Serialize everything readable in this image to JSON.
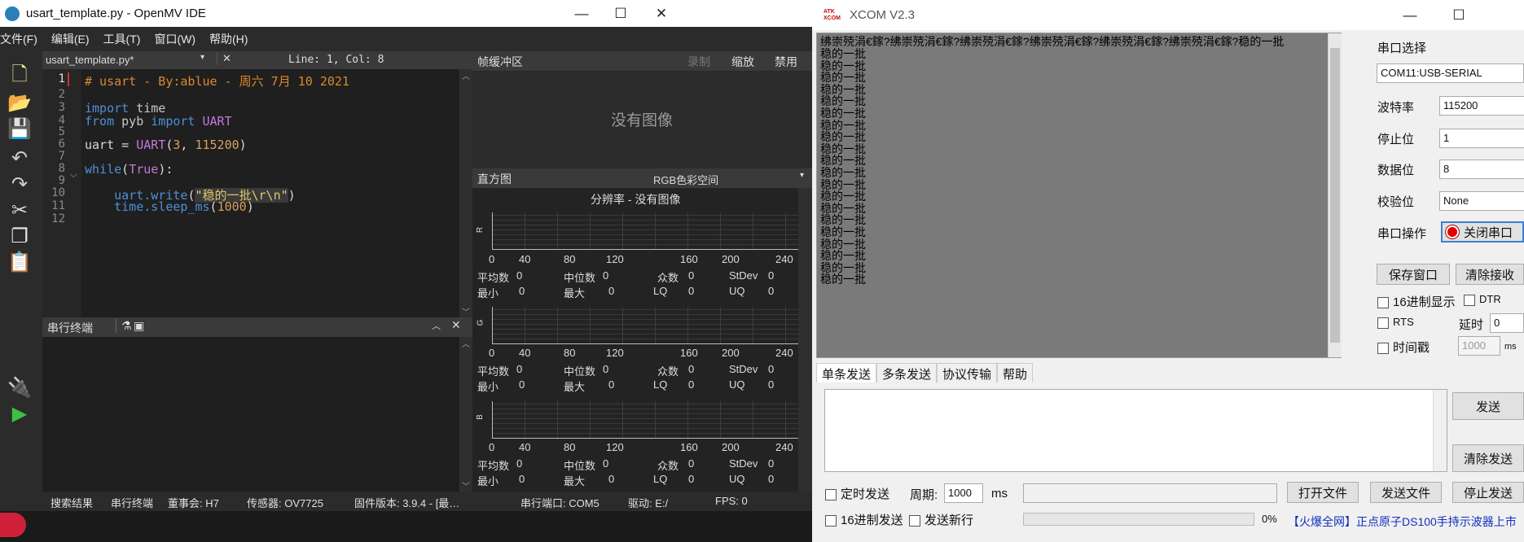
{
  "openmv": {
    "title": "usart_template.py - OpenMV IDE",
    "menu": [
      "文件(F)",
      "编辑(E)",
      "工具(T)",
      "窗口(W)",
      "帮助(H)"
    ],
    "editor": {
      "tab": "usart_template.py*",
      "line_col": "Line: 1, Col: 8",
      "line_numbers": [
        "1",
        "2",
        "3",
        "4",
        "5",
        "6",
        "7",
        "8",
        "9",
        "10",
        "11",
        "12"
      ],
      "lines": [
        "# usart - By:ablue - 周六 7月 10 2021",
        "",
        "import time",
        "from pyb import UART",
        "",
        "uart = UART(3, 115200)",
        "",
        "while(True):",
        "",
        "    uart.write(\"稳的一批\\r\\n\")",
        "    time.sleep_ms(1000)",
        ""
      ]
    },
    "terminal": {
      "title": "串行终端"
    },
    "framebuffer": {
      "title": "帧缓冲区",
      "record": "录制",
      "zoom": "缩放",
      "disable": "禁用",
      "no_image": "没有图像"
    },
    "histogram": {
      "title": "直方图",
      "colorspace": "RGB色彩空间",
      "resolution": "分辨率 - 没有图像",
      "channels": [
        "R",
        "G",
        "B"
      ],
      "ticks": [
        "0",
        "40",
        "80",
        "120",
        "160",
        "200",
        "240"
      ],
      "stats_row1": {
        "mean": "平均数",
        "median": "中位数",
        "mode": "众数",
        "stdev": "StDev"
      },
      "stats_row2": {
        "min": "最小",
        "max": "最大",
        "lq": "LQ",
        "uq": "UQ"
      },
      "zero": "0"
    },
    "status": {
      "search": "搜索结果",
      "serial": "串行终端",
      "board": "董事会: H7",
      "sensor": "传感器: OV7725",
      "firmware": "固件版本: 3.9.4 - [最…",
      "port": "串行端口: COM5",
      "drive": "驱动: E:/",
      "fps": "FPS: 0"
    }
  },
  "xcom": {
    "title": "XCOM V2.3",
    "logo": "ATK XCOM",
    "receive": {
      "first_line": "绋崇殑涓€鎵?绋崇殑涓€鎵?绋崇殑涓€鎵?绋崇殑涓€鎵?绋崇殑涓€鎵?绋崇殑涓€鎵?稳的一批",
      "lines": [
        "稳的一批",
        "稳的一批",
        "稳的一批",
        "稳的一批",
        "稳的一批",
        "稳的一批",
        "稳的一批",
        "稳的一批",
        "稳的一批",
        "稳的一批",
        "稳的一批",
        "稳的一批",
        "稳的一批",
        "稳的一批",
        "稳的一批",
        "稳的一批",
        "稳的一批",
        "稳的一批",
        "稳的一批",
        "稳的一批"
      ]
    },
    "side": {
      "port_label": "串口选择",
      "port_value": "COM11:USB-SERIAL",
      "baud_label": "波特率",
      "baud_value": "115200",
      "stop_label": "停止位",
      "stop_value": "1",
      "data_label": "数据位",
      "data_value": "8",
      "parity_label": "校验位",
      "parity_value": "None",
      "op_label": "串口操作",
      "op_button": "关闭串口",
      "save_window": "保存窗口",
      "clear_recv": "清除接收",
      "hex_display": "16进制显示",
      "dtr": "DTR",
      "rts": "RTS",
      "delay_label": "延时",
      "delay_value": "0",
      "timestamp": "时间戳",
      "timestamp_value": "1000",
      "ms": "ms"
    },
    "tabs": [
      "单条发送",
      "多条发送",
      "协议传输",
      "帮助"
    ],
    "send": {
      "send_button": "发送",
      "clear_send": "清除发送",
      "timed_send": "定时发送",
      "period_label": "周期:",
      "period_value": "1000",
      "ms": "ms",
      "open_file": "打开文件",
      "send_file": "发送文件",
      "stop_send": "停止发送",
      "hex_send": "16进制发送",
      "newline": "发送新行",
      "progress": "0%",
      "ad": "【火爆全网】正点原子DS100手持示波器上市"
    }
  }
}
